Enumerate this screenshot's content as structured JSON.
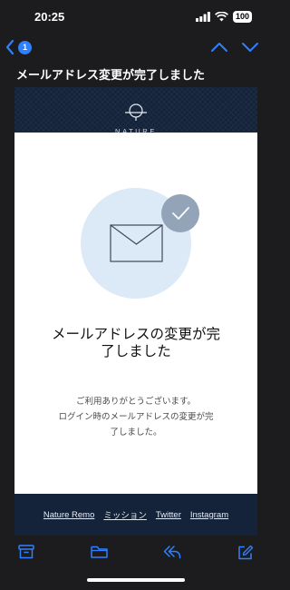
{
  "status_bar": {
    "time": "20:25",
    "battery": "100",
    "icons": [
      "signal-icon",
      "wifi-icon",
      "battery-icon"
    ]
  },
  "nav": {
    "unread_count": "1",
    "icons": [
      "back-chevron-icon",
      "up-chevron-icon",
      "down-chevron-icon"
    ]
  },
  "email": {
    "subject": "メールアドレス変更が完了しました",
    "brand_name": "NATURE",
    "heading_line1": "メールアドレスの変更が完",
    "heading_line2": "了しました",
    "message_line1": "ご利用ありがとうございます。",
    "message_line2": "ログイン時のメールアドレスの変更が完",
    "message_line3": "了しました。",
    "footer_links": [
      "Nature Remo",
      "ミッション",
      "Twitter",
      "Instagram"
    ]
  },
  "toolbar": {
    "icons": [
      "archive-icon",
      "folder-icon",
      "reply-icon",
      "compose-icon"
    ]
  },
  "colors": {
    "accent": "#2f80ff",
    "email_header_bg": "#14233a",
    "illustration_circle": "#dce9f6",
    "check_badge": "#93a4b8"
  }
}
